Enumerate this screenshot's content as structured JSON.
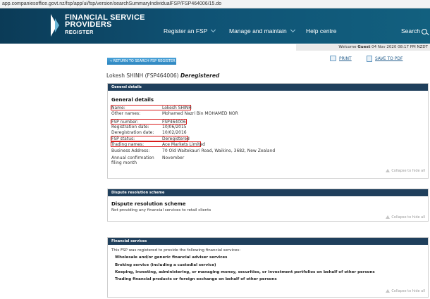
{
  "browser": {
    "url": "app.companiesoffice.govt.nz/fsp/app/ui/fsp/version/searchSummaryIndividualFSP/FSP464006/15.do"
  },
  "header": {
    "logo_line1": "FINANCIAL SERVICE",
    "logo_line2": "PROVIDERS",
    "logo_line3": "REGISTER",
    "nav": {
      "register": "Register an FSP",
      "manage": "Manage and maintain",
      "help": "Help centre",
      "search": "Search"
    }
  },
  "welcome": {
    "prefix": "Welcome",
    "user": "Guest",
    "datetime": "04 Nov 2020 08:17 PM NZDT"
  },
  "actions": {
    "print": "PRINT",
    "pdf": "SAVE TO PDF",
    "return": "RETURN TO SEARCH FSP REGISTER"
  },
  "title": {
    "name": "Lokesh SHINH (FSP464006)",
    "status": "Deregistered"
  },
  "general": {
    "header": "General details",
    "heading": "General details",
    "rows": [
      {
        "label": "Name:",
        "value": "Lokesh SHINH"
      },
      {
        "label": "Other names:",
        "value": "Mohamed Nazri Bin MOHAMED NOR"
      },
      {
        "label": "FSP number:",
        "value": "FSP464006"
      },
      {
        "label": "Registration date:",
        "value": "10/06/2015"
      },
      {
        "label": "Deregistration date:",
        "value": "10/02/2016"
      },
      {
        "label": "FSP status:",
        "value": "Deregistered"
      },
      {
        "label": "Trading names:",
        "value": "Ace Markets Limited"
      },
      {
        "label": "Business Address:",
        "value": "70 Old Waitekauri Road, Waikino, 3682, New Zealand"
      },
      {
        "label": "Annual confirmation",
        "label2": "filing month",
        "value": "November"
      }
    ],
    "collapse": "Collapse to hide all"
  },
  "dispute": {
    "header": "Dispute resolution scheme",
    "heading": "Dispute resolution scheme",
    "text": "Not providing any financial services to retail clients",
    "collapse": "Collapse to hide all"
  },
  "services": {
    "header": "Financial services",
    "intro": "This FSP was registered to provide the following financial services:",
    "items": [
      "Wholesale and/or generic financial adviser services",
      "Broking service (including a custodial service)",
      "Keeping, investing, administering, or managing money, securities, or investment portfolios on behalf of other persons",
      "Trading financial products or foreign exchange on behalf of other persons"
    ],
    "collapse": "Collapse to hide all"
  }
}
